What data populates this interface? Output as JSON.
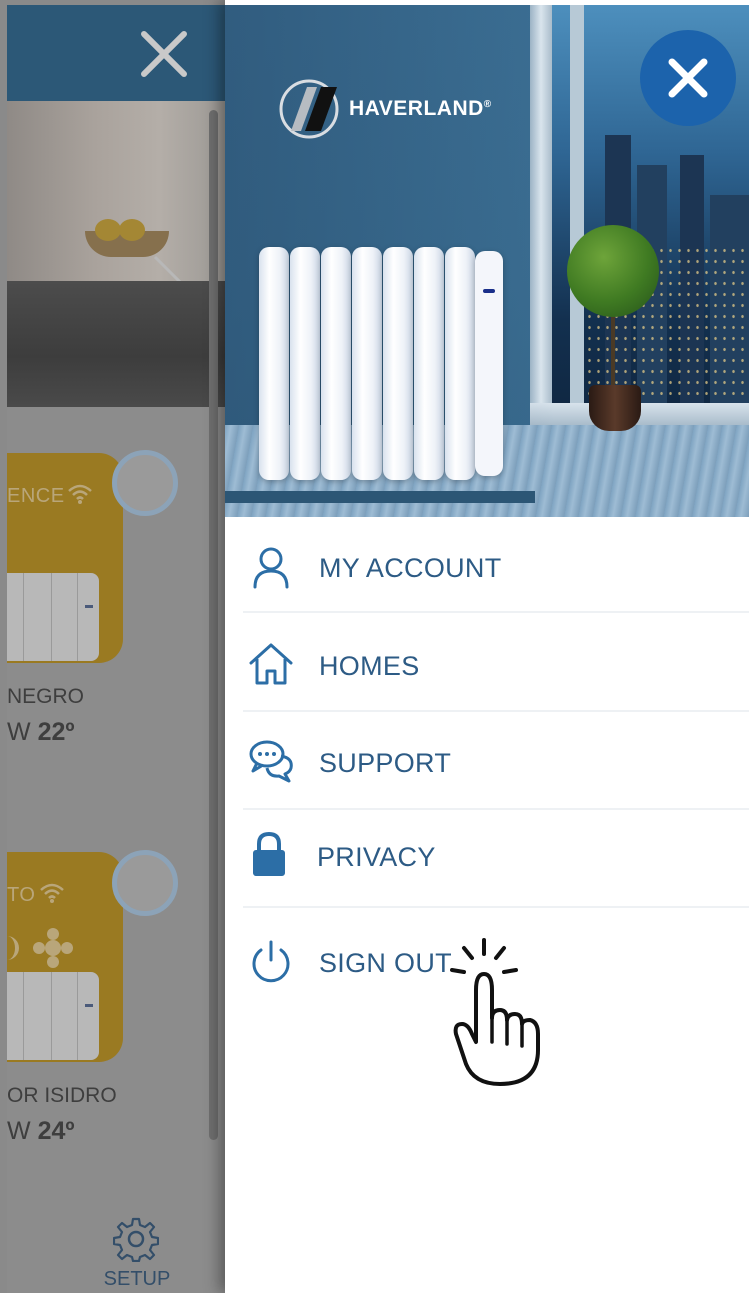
{
  "background_app": {
    "devices": [
      {
        "mode": "ENCE",
        "name": "NEGRO",
        "power_prefix": "W",
        "temperature": "22º"
      },
      {
        "mode": "TO",
        "name": "OR ISIDRO",
        "power_prefix": "W",
        "temperature": "24º"
      }
    ],
    "setup_label": "SETUP"
  },
  "drawer": {
    "brand": {
      "name": "HAVERLAND",
      "registered": "®"
    },
    "menu": [
      {
        "label": "MY ACCOUNT",
        "icon": "user-icon"
      },
      {
        "label": "HOMES",
        "icon": "home-icon"
      },
      {
        "label": "SUPPORT",
        "icon": "chat-bubbles-icon"
      },
      {
        "label": "PRIVACY",
        "icon": "lock-icon"
      },
      {
        "label": "SIGN OUT",
        "icon": "power-icon"
      }
    ]
  },
  "colors": {
    "accent_blue": "#1c63ac",
    "menu_text": "#2d5b85",
    "menu_icon": "#2c6ea6",
    "background_header": "#2c5877",
    "card_yellow_dimmed": "#9a7a22"
  },
  "overlay": {
    "gesture": "tap-hand-icon"
  }
}
